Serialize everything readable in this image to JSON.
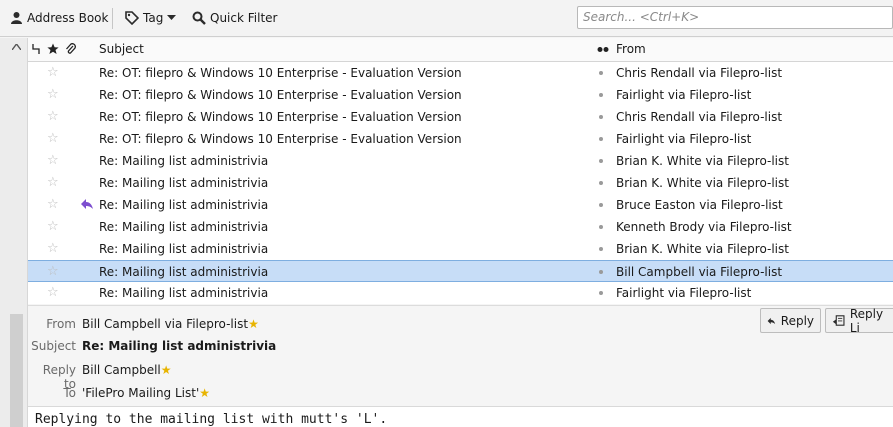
{
  "toolbar": {
    "address_book": "Address Book",
    "tag": "Tag",
    "quick_filter": "Quick Filter",
    "search_placeholder": "Search... <Ctrl+K>"
  },
  "columns": {
    "subject": "Subject",
    "from": "From"
  },
  "messages": [
    {
      "subject": "Re: OT: filepro & Windows 10 Enterprise - Evaluation Version",
      "from": "Chris Rendall via Filepro-list"
    },
    {
      "subject": "Re: OT: filepro & Windows 10 Enterprise - Evaluation Version",
      "from": "Fairlight via Filepro-list"
    },
    {
      "subject": "Re: OT: filepro & Windows 10 Enterprise - Evaluation Version",
      "from": "Chris Rendall via Filepro-list"
    },
    {
      "subject": "Re: OT: filepro & Windows 10 Enterprise - Evaluation Version",
      "from": "Fairlight via Filepro-list"
    },
    {
      "subject": "Re: Mailing list administrivia",
      "from": "Brian K. White via Filepro-list"
    },
    {
      "subject": "Re: Mailing list administrivia",
      "from": "Brian K. White via Filepro-list"
    },
    {
      "subject": "Re: Mailing list administrivia",
      "from": "Bruce Easton via Filepro-list"
    },
    {
      "subject": "Re: Mailing list administrivia",
      "from": "Kenneth Brody via Filepro-list"
    },
    {
      "subject": "Re: Mailing list administrivia",
      "from": "Brian K. White via Filepro-list"
    },
    {
      "subject": "Re: Mailing list administrivia",
      "from": "Bill Campbell via Filepro-list"
    },
    {
      "subject": "Re: Mailing list administrivia",
      "from": "Fairlight via Filepro-list"
    }
  ],
  "header": {
    "from_label": "From",
    "from_value": "Bill Campbell via Filepro-list",
    "subject_label": "Subject",
    "subject_value": "Re: Mailing list administrivia",
    "replyto_label": "Reply to",
    "replyto_value": "Bill Campbell",
    "to_label": "To",
    "to_value": "'FilePro Mailing List'",
    "reply_button": "Reply",
    "reply_list_button": "Reply Li"
  },
  "body": {
    "text": "Replying to the mailing list with mutt's 'L'."
  },
  "colors": {
    "selected_row": "#c7ddf7",
    "replied_arrow": "#7d4fcf",
    "star_contact": "#e8b400"
  }
}
